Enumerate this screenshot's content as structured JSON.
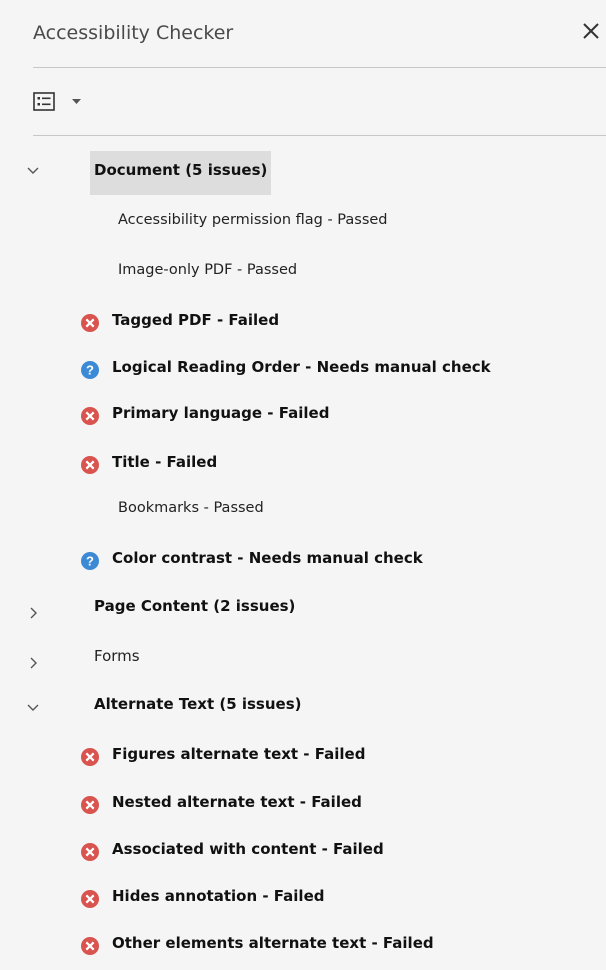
{
  "panel": {
    "title": "Accessibility Checker",
    "close_icon": "close-icon",
    "options_icon": "list-options-icon",
    "options_caret_icon": "caret-down-icon"
  },
  "colors": {
    "failed": "#d9534f",
    "needs_check": "#3c8ad6",
    "highlight": "#dddddd"
  },
  "tree": {
    "document": {
      "label": "Document (5 issues)",
      "expanded": true,
      "items": [
        {
          "label": "Accessibility permission flag - Passed",
          "status": "passed"
        },
        {
          "label": "Image-only PDF - Passed",
          "status": "passed"
        },
        {
          "label": "Tagged PDF - Failed",
          "status": "failed",
          "icon": "failed-icon"
        },
        {
          "label": "Logical Reading Order - Needs manual check",
          "status": "needs-check",
          "icon": "help-icon"
        },
        {
          "label": "Primary language - Failed",
          "status": "failed",
          "icon": "failed-icon"
        },
        {
          "label": "Title - Failed",
          "status": "failed",
          "icon": "failed-icon"
        },
        {
          "label": "Bookmarks - Passed",
          "status": "passed"
        },
        {
          "label": "Color contrast - Needs manual check",
          "status": "needs-check",
          "icon": "help-icon"
        }
      ]
    },
    "page_content": {
      "label": "Page Content (2 issues)",
      "expanded": false
    },
    "forms": {
      "label": "Forms",
      "expanded": false
    },
    "alternate_text": {
      "label": "Alternate Text (5 issues)",
      "expanded": true,
      "items": [
        {
          "label": "Figures alternate text - Failed",
          "status": "failed",
          "icon": "failed-icon"
        },
        {
          "label": "Nested alternate text - Failed",
          "status": "failed",
          "icon": "failed-icon"
        },
        {
          "label": "Associated with content - Failed",
          "status": "failed",
          "icon": "failed-icon"
        },
        {
          "label": "Hides annotation - Failed",
          "status": "failed",
          "icon": "failed-icon"
        },
        {
          "label": "Other elements alternate text - Failed",
          "status": "failed",
          "icon": "failed-icon"
        }
      ]
    }
  }
}
